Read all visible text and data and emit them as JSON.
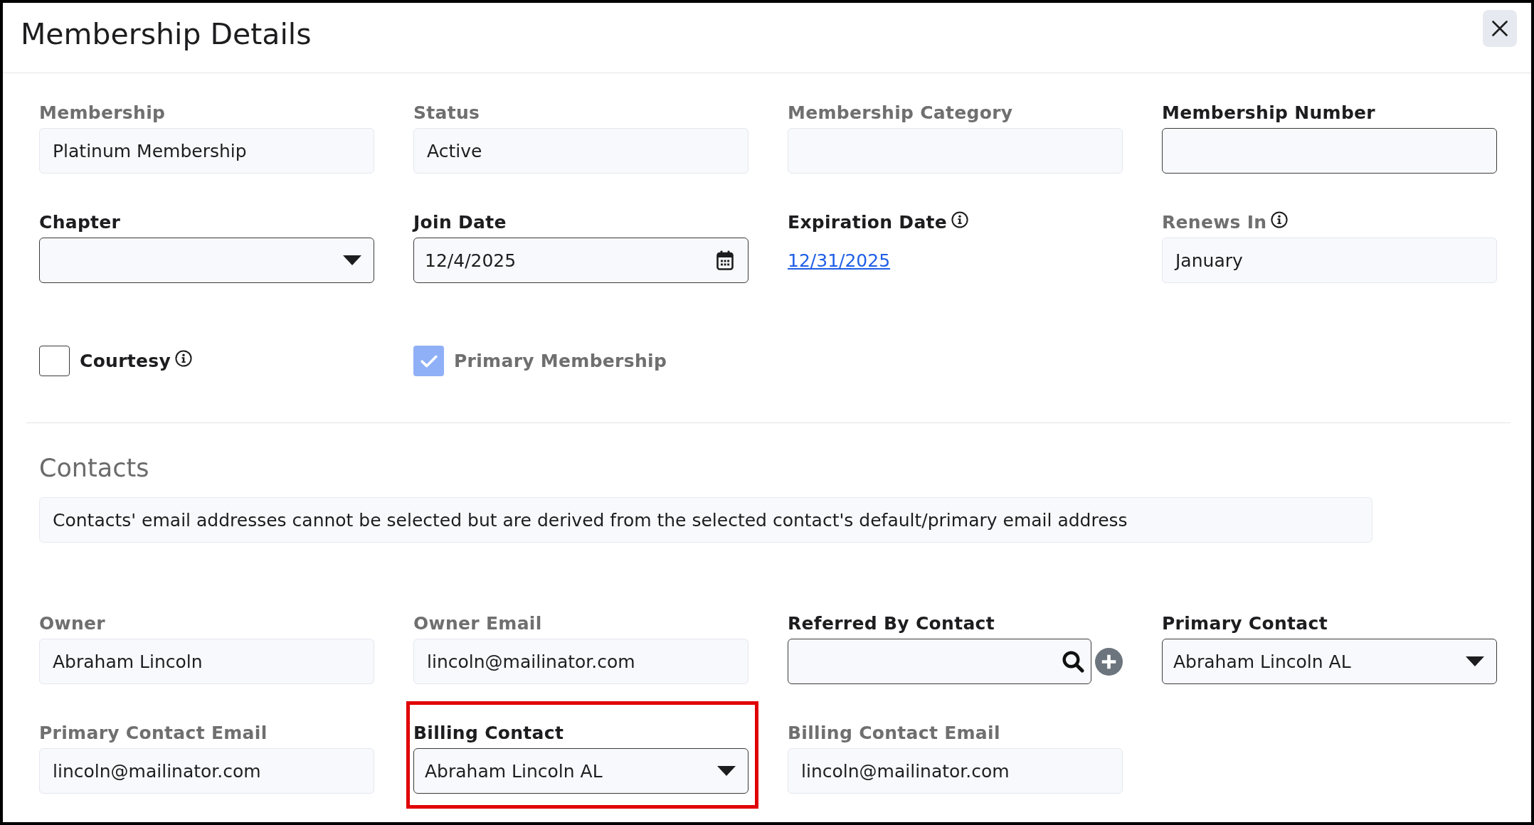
{
  "dialog": {
    "title": "Membership Details"
  },
  "membership_fields": [
    {
      "label": "Membership",
      "kind": "readonly",
      "value": "Platinum Membership",
      "info": false
    },
    {
      "label": "Status",
      "kind": "readonly",
      "value": "Active",
      "info": false
    },
    {
      "label": "Membership Category",
      "kind": "readonly",
      "info": false
    },
    {
      "label": "Membership Number",
      "kind": "input",
      "info": false
    },
    {
      "label": "Chapter",
      "kind": "select",
      "info": false
    },
    {
      "label": "Join Date",
      "kind": "date",
      "value": "12/4/2025",
      "info": false
    },
    {
      "label": "Expiration Date",
      "kind": "link",
      "value": "12/31/2025",
      "info": true
    },
    {
      "label": "Renews In",
      "kind": "readonly",
      "value": "January",
      "info": true
    }
  ],
  "checkboxes": [
    {
      "label": "Courtesy",
      "checked": false,
      "disabled": false,
      "info": true
    },
    {
      "label": "Primary Membership",
      "checked": true,
      "disabled": true,
      "info": false
    }
  ],
  "contacts": {
    "title": "Contacts",
    "notice": "Contacts' email addresses cannot be selected but are derived from the selected contact's default/primary email address",
    "fields": [
      {
        "label": "Owner",
        "kind": "readonly",
        "value": "Abraham Lincoln",
        "highlighted": false
      },
      {
        "label": "Owner Email",
        "kind": "readonly",
        "value": "lincoln@mailinator.com",
        "highlighted": false
      },
      {
        "label": "Referred By Contact",
        "kind": "search",
        "highlighted": false
      },
      {
        "label": "Primary Contact",
        "kind": "select",
        "value": "Abraham Lincoln AL",
        "highlighted": false
      },
      {
        "label": "Primary Contact Email",
        "kind": "readonly",
        "value": "lincoln@mailinator.com",
        "highlighted": false
      },
      {
        "label": "Billing Contact",
        "kind": "select",
        "value": "Abraham Lincoln AL",
        "highlighted": true
      },
      {
        "label": "Billing Contact Email",
        "kind": "readonly",
        "value": "lincoln@mailinator.com",
        "highlighted": false
      }
    ]
  }
}
